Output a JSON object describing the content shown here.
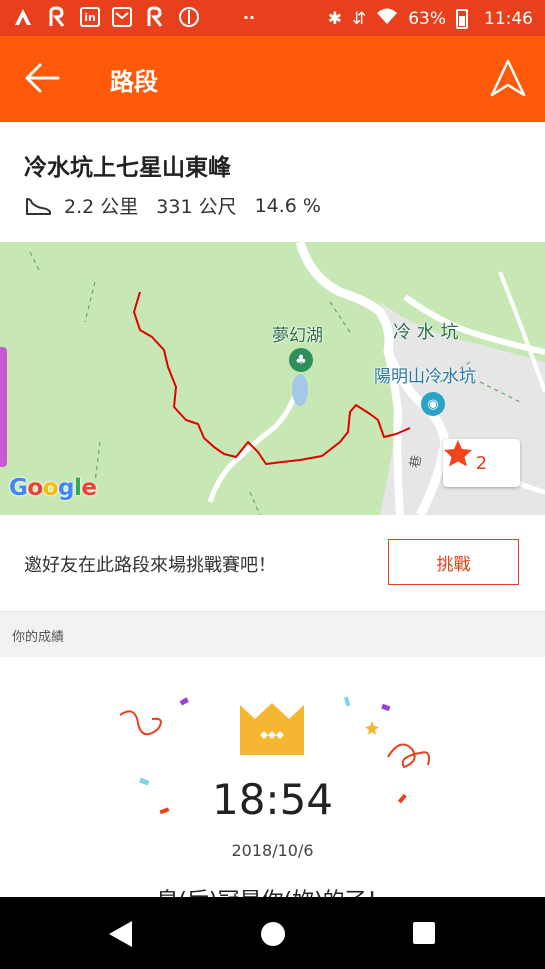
{
  "status_bar": {
    "battery": "63%",
    "time": "11:46",
    "icons": [
      "strava-icon",
      "route-icon",
      "linkedin-icon",
      "gmail-icon",
      "route-icon",
      "compass-icon",
      "more-dots-icon",
      "bluetooth-icon",
      "data-icon",
      "wifi-icon",
      "battery-icon"
    ]
  },
  "app_bar": {
    "title": "路段",
    "back_icon": "arrow-left-icon",
    "navigate_icon": "navigation-arrow-icon"
  },
  "segment": {
    "name": "冷水坑上七星山東峰",
    "distance": "2.2 公里",
    "elevation": "331 公尺",
    "grade": "14.6 %",
    "type_icon": "shoe-icon"
  },
  "map": {
    "labels": {
      "lake": "夢幻湖",
      "area": "冷 水 坑",
      "poi": "陽明山冷水坑",
      "road": "巷"
    },
    "favorite_count": "2",
    "logo": [
      "G",
      "o",
      "o",
      "g",
      "l",
      "e"
    ],
    "route_color": "#e00000"
  },
  "challenge": {
    "prompt": "邀好友在此路段來場挑戰賽吧！",
    "button": "挑戰"
  },
  "results": {
    "section_label": "你的成績",
    "time": "18:54",
    "date": "2018/10/6",
    "tagline": "皇(后)冠是你(妳)的了！"
  },
  "colors": {
    "accent": "#ff5a0a",
    "status_bar": "#e8401c",
    "crown": "#f5b731"
  }
}
